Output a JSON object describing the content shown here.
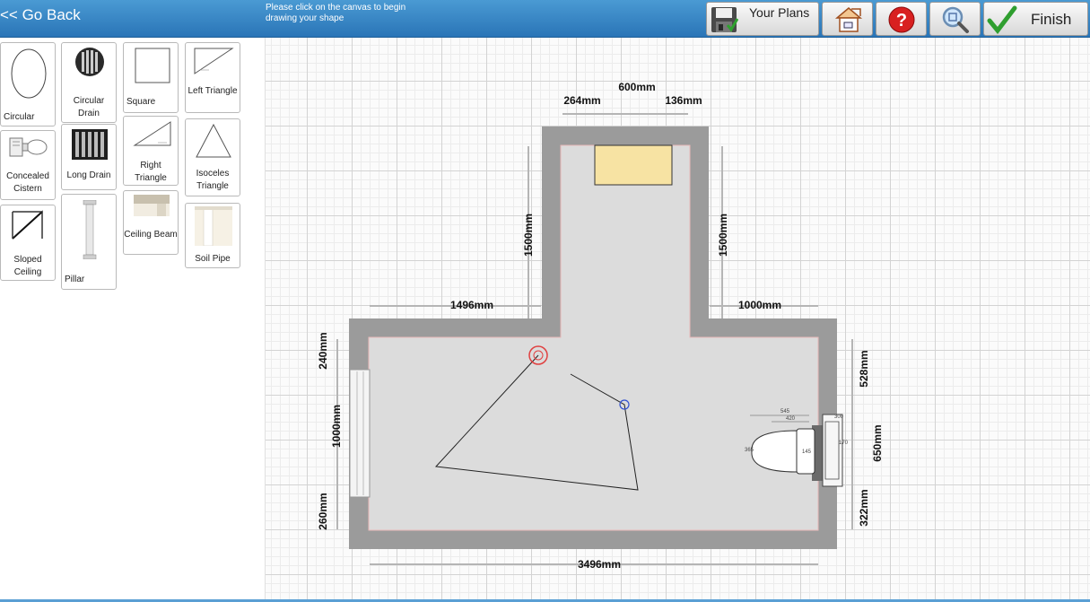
{
  "toolbar": {
    "go_back_label": "<< Go Back",
    "hint": "Please click on the canvas to begin drawing your shape",
    "your_plans_label": "Your Plans",
    "finish_label": "Finish",
    "icons": [
      "save-icon",
      "room-shape-icon",
      "help-icon",
      "zoom-icon",
      "checkmark-icon"
    ]
  },
  "palette": {
    "items": [
      {
        "label": "Circular",
        "icon": "circular-shape-icon"
      },
      {
        "label": "Circular Drain",
        "icon": "circular-drain-icon"
      },
      {
        "label": "Square",
        "icon": "square-shape-icon"
      },
      {
        "label": "Left Triangle",
        "icon": "left-triangle-icon"
      },
      {
        "label": "Concealed Cistern",
        "icon": "concealed-cistern-icon"
      },
      {
        "label": "Long Drain",
        "icon": "long-drain-icon"
      },
      {
        "label": "Right Triangle",
        "icon": "right-triangle-icon"
      },
      {
        "label": "Isoceles Triangle",
        "icon": "isosceles-triangle-icon"
      },
      {
        "label": "Sloped Ceiling",
        "icon": "sloped-ceiling-icon"
      },
      {
        "label": "Pillar",
        "icon": "pillar-icon"
      },
      {
        "label": "Ceiling Beam",
        "icon": "ceiling-beam-icon"
      },
      {
        "label": "Soil Pipe",
        "icon": "soil-pipe-icon"
      }
    ]
  },
  "plan": {
    "dimensions": {
      "top_total": "600mm",
      "top_left": "264mm",
      "top_right": "136mm",
      "alcove_left_wall": "1500mm",
      "alcove_right_wall": "1500mm",
      "main_top_left": "1496mm",
      "main_top_right": "1000mm",
      "left_upper": "240mm",
      "left_middle": "1000mm",
      "left_lower": "260mm",
      "right_upper": "528mm",
      "right_middle": "650mm",
      "right_lower": "322mm",
      "bottom": "3496mm"
    },
    "toilet_small_labels": [
      "545",
      "420",
      "365",
      "145",
      "170",
      "300"
    ],
    "colors": {
      "wall": "#9b9b9b",
      "floor": "#dcdcdc",
      "radiator": "#f7e3a3",
      "start_marker": "#e04040",
      "end_marker": "#3050d0"
    }
  }
}
